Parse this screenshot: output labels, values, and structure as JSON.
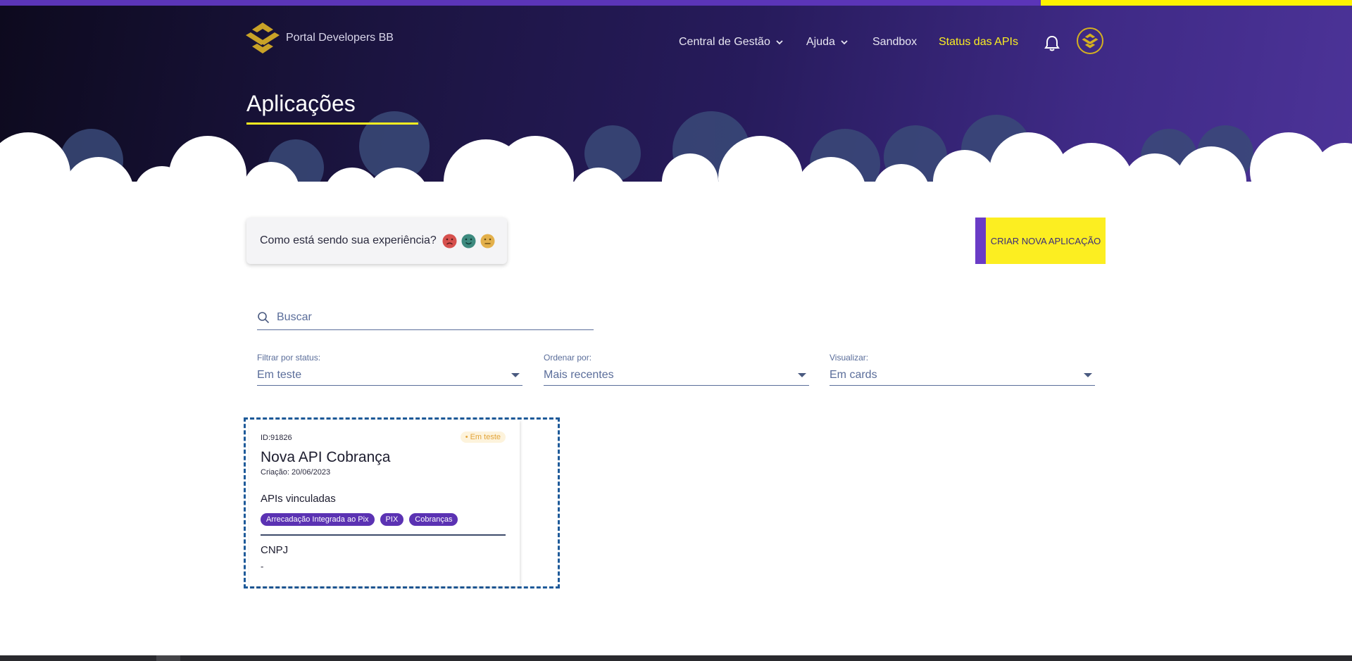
{
  "header": {
    "logo_text": "Portal Developers BB",
    "nav": [
      {
        "label": "Central de Gestão"
      },
      {
        "label": "Ajuda"
      },
      {
        "label": "Sandbox"
      },
      {
        "label": "Status das APIs"
      }
    ],
    "page_title": "Aplicações"
  },
  "feedback": {
    "question": "Como está sendo sua experiência?",
    "faces": [
      "sad-face-icon",
      "happy-face-icon",
      "neutral-face-icon"
    ]
  },
  "actions": {
    "create_label": "CRIAR NOVA APLICAÇÃO"
  },
  "search": {
    "placeholder": "Buscar"
  },
  "filters": [
    {
      "label": "Filtrar por status:",
      "value": "Em teste"
    },
    {
      "label": "Ordenar por:",
      "value": "Mais recentes"
    },
    {
      "label": "Visualizar:",
      "value": "Em cards"
    }
  ],
  "apps": [
    {
      "id": "ID:91826",
      "status": "• Em teste",
      "name": "Nova API Cobrança",
      "created": "Criação: 20/06/2023",
      "apis_title": "APIs vinculadas",
      "apis": [
        "Arrecadação Integrada ao Pix",
        "PIX",
        "Cobranças"
      ],
      "cnpj_title": "CNPJ",
      "cnpj_value": "-"
    }
  ],
  "colors": {
    "accent_yellow": "#fcee21",
    "accent_purple": "#5b32b3",
    "status_test": "#e2a43b"
  }
}
